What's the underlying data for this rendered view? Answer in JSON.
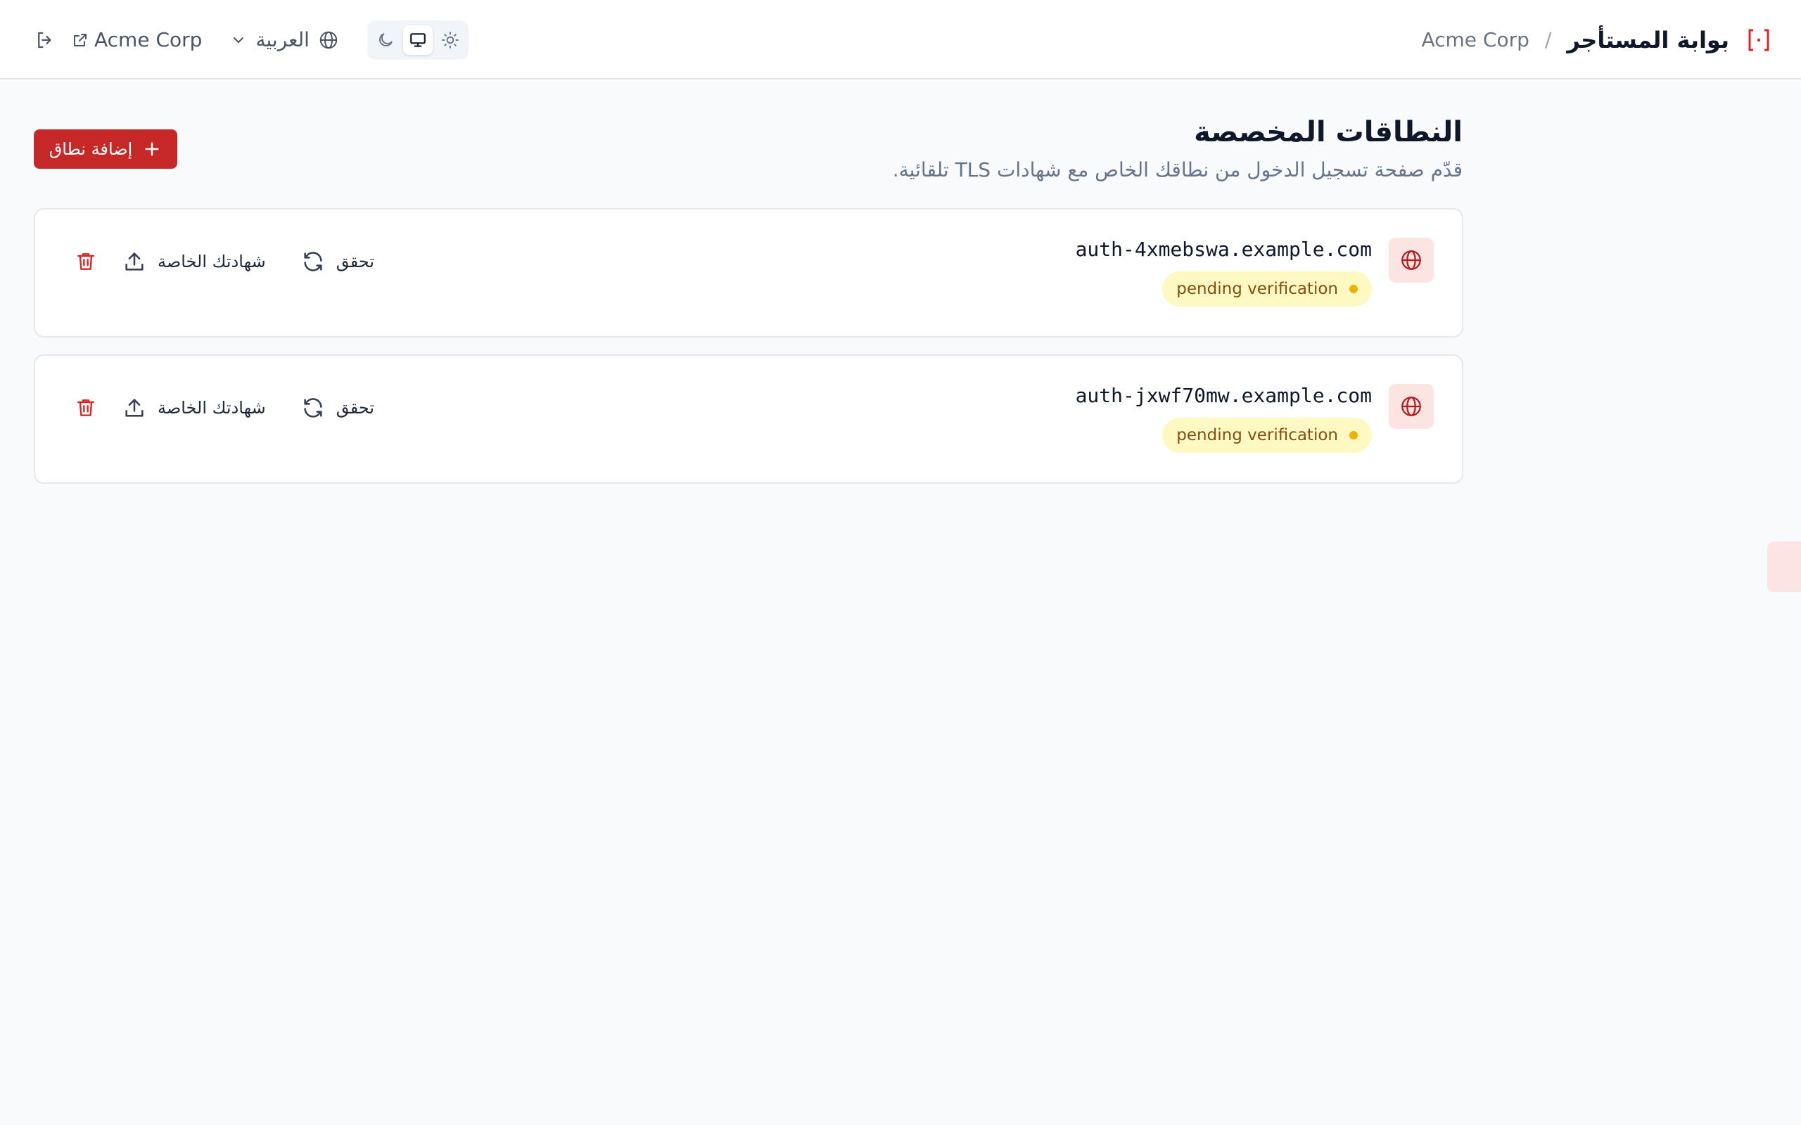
{
  "header": {
    "title": "بوابة المستأجر",
    "separator": "/",
    "org": "Acme Corp",
    "org_link": "Acme Corp",
    "language": "العربية",
    "theme_modes": [
      "dark",
      "system",
      "light"
    ],
    "active_theme": "system"
  },
  "page": {
    "title": "النطاقات المخصصة",
    "subtitle": "قدّم صفحة تسجيل الدخول من نطاقك الخاص مع شهادات TLS تلقائية.",
    "add_button": "إضافة نطاق"
  },
  "domains": [
    {
      "domain": "auth-4xmebswa.example.com",
      "status": "pending verification",
      "verify_label": "تحقق",
      "cert_label": "شهادتك الخاصة"
    },
    {
      "domain": "auth-jxwf70mw.example.com",
      "status": "pending verification",
      "verify_label": "تحقق",
      "cert_label": "شهادتك الخاصة"
    }
  ],
  "colors": {
    "accent": "#c62828",
    "badge_bg": "#fef9c3",
    "badge_dot": "#eab308",
    "icon_bg": "#fbe4e2"
  }
}
